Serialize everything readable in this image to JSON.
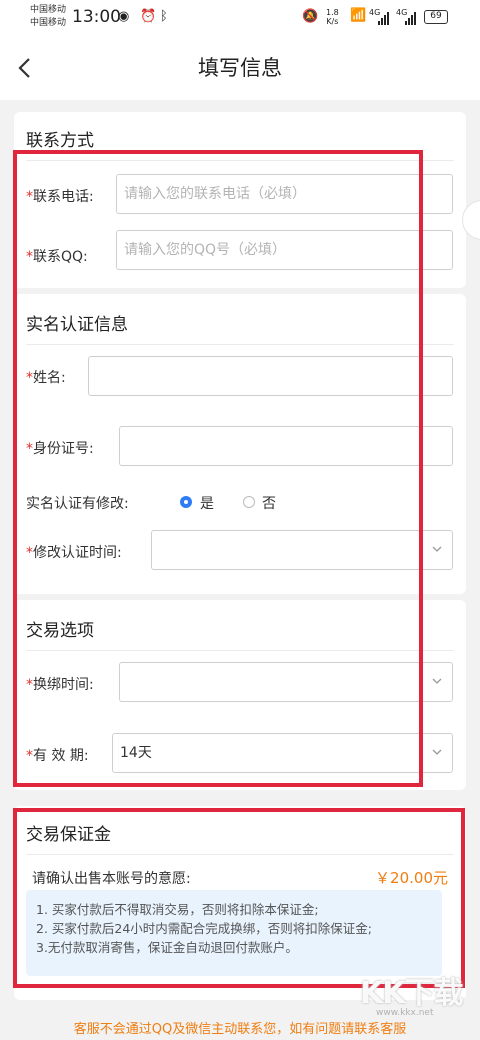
{
  "statusbar": {
    "carrier1": "中国移动",
    "carrier2": "中国移动",
    "time": "13:00",
    "net_speed_value": "1.8",
    "net_speed_unit": "K/s",
    "signal1_label": "4G",
    "signal2_label": "4G",
    "battery": "69"
  },
  "nav": {
    "title": "填写信息"
  },
  "contact": {
    "title": "联系方式",
    "phone_label": "联系电话:",
    "phone_placeholder": "请输入您的联系电话（必填）",
    "qq_label": "联系QQ:",
    "qq_placeholder": "请输入您的QQ号（必填）"
  },
  "realname": {
    "title": "实名认证信息",
    "name_label": "姓名:",
    "name_value": "",
    "id_label": "身份证号:",
    "id_value": "",
    "modified_label": "实名认证有修改:",
    "option_yes": "是",
    "option_no": "否",
    "selected": "是",
    "modify_time_label": "修改认证时间:",
    "modify_time_value": ""
  },
  "trade": {
    "title": "交易选项",
    "rebind_label": "换绑时间:",
    "rebind_value": "",
    "validity_label": "有 效 期:",
    "validity_value": "14天"
  },
  "deposit": {
    "title": "交易保证金",
    "confirm_text": "请确认出售本账号的意愿:",
    "amount": "￥20.00元",
    "notes": [
      "1. 买家付款后不得取消交易，否则将扣除本保证金;",
      "2. 买家付款后24小时内需配合完成换绑，否则将扣除保证金;",
      "3.无付款取消寄售，保证金自动退回付款账户。"
    ]
  },
  "footer": {
    "text": "客服不会通过QQ及微信主动联系您，如有问题请联系客服"
  },
  "watermark": {
    "logo": "KK下载",
    "url": "www.kkx.net"
  },
  "colors": {
    "required": "#e0322e",
    "accent": "#f07d10",
    "radio": "#2f7df6",
    "highlight_box": "#e0263d",
    "notice_bg": "#e9f3fd"
  }
}
